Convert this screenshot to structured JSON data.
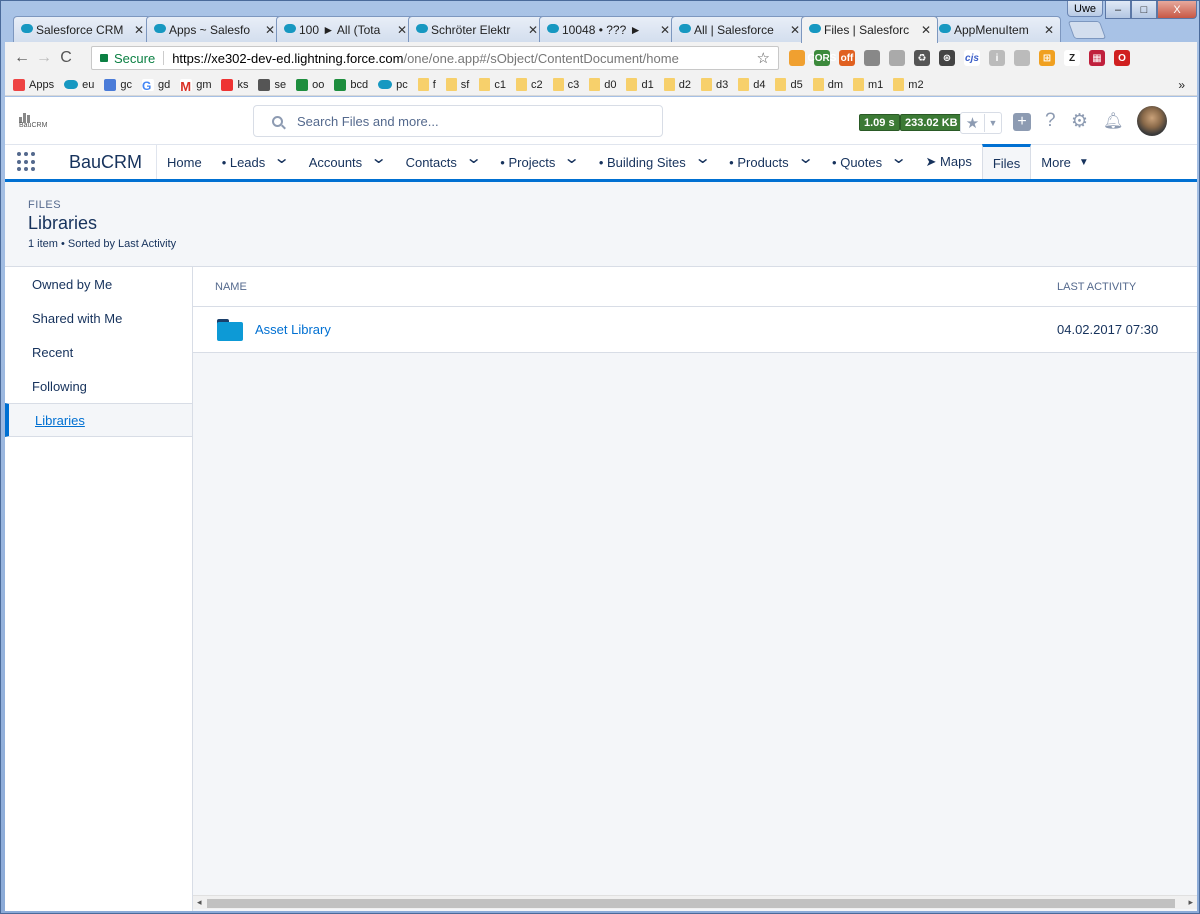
{
  "browser": {
    "user": "Uwe",
    "tabs": [
      {
        "label": "Salesforce CRM",
        "active": false
      },
      {
        "label": "Apps ~ Salesfo",
        "active": false
      },
      {
        "label": "100 ► All (Tota",
        "active": false
      },
      {
        "label": "Schröter Elektr",
        "active": false
      },
      {
        "label": "10048 • ??? ►",
        "active": false
      },
      {
        "label": "All | Salesforce",
        "active": false
      },
      {
        "label": "Files | Salesforc",
        "active": true
      },
      {
        "label": "AppMenuItem",
        "active": false
      }
    ],
    "address": {
      "secure_label": "Secure",
      "url_host": "https://xe302-dev-ed.lightning.force.com",
      "url_path": "/one/one.app#/sObject/ContentDocument/home"
    },
    "extensions": [
      {
        "name": "calculator-icon",
        "color": "#f0a030",
        "text": ""
      },
      {
        "name": "cors-icon",
        "color": "#3c8a3c",
        "text": "CORS"
      },
      {
        "name": "off-icon",
        "color": "#e06020",
        "text": "off"
      },
      {
        "name": "tab-icon",
        "color": "#888888",
        "text": ""
      },
      {
        "name": "drive-icon",
        "color": "#aaaaaa",
        "text": ""
      },
      {
        "name": "recycle-icon",
        "color": "#555555",
        "text": "♻"
      },
      {
        "name": "steering-icon",
        "color": "#444444",
        "text": "⊛"
      },
      {
        "name": "cjs-icon",
        "color": "#ffffff",
        "text": "cjs"
      },
      {
        "name": "info-icon",
        "color": "#bbbbbb",
        "text": "i"
      },
      {
        "name": "cloud-icon",
        "color": "#bbbbbb",
        "text": ""
      },
      {
        "name": "grid-ext-icon",
        "color": "#f0a020",
        "text": "⊞"
      },
      {
        "name": "z-icon",
        "color": "#ffffff",
        "text": "Z"
      },
      {
        "name": "flag-icon",
        "color": "#c0203c",
        "text": "▦"
      },
      {
        "name": "opera-icon",
        "color": "#d02020",
        "text": "O"
      }
    ],
    "bookmarks": [
      {
        "label": "Apps",
        "icon": "grid"
      },
      {
        "label": "eu",
        "icon": "sf"
      },
      {
        "label": "gc",
        "icon": "calendar"
      },
      {
        "label": "gd",
        "icon": "google"
      },
      {
        "label": "gm",
        "icon": "gmail"
      },
      {
        "label": "ks",
        "icon": "bank"
      },
      {
        "label": "se",
        "icon": "cloud"
      },
      {
        "label": "oo",
        "icon": "sheet"
      },
      {
        "label": "bcd",
        "icon": "sheet"
      },
      {
        "label": "pc",
        "icon": "sf"
      },
      {
        "label": "f",
        "icon": "folder"
      },
      {
        "label": "sf",
        "icon": "folder"
      },
      {
        "label": "c1",
        "icon": "folder"
      },
      {
        "label": "c2",
        "icon": "folder"
      },
      {
        "label": "c3",
        "icon": "folder"
      },
      {
        "label": "d0",
        "icon": "folder"
      },
      {
        "label": "d1",
        "icon": "folder"
      },
      {
        "label": "d2",
        "icon": "folder"
      },
      {
        "label": "d3",
        "icon": "folder"
      },
      {
        "label": "d4",
        "icon": "folder"
      },
      {
        "label": "d5",
        "icon": "folder"
      },
      {
        "label": "dm",
        "icon": "folder"
      },
      {
        "label": "m1",
        "icon": "folder"
      },
      {
        "label": "m2",
        "icon": "folder"
      }
    ],
    "bookmarks_more": "»"
  },
  "sf": {
    "logo_text": "BauCRM",
    "search_placeholder": "Search Files and more...",
    "perf_time": "1.09 s",
    "perf_size": "233.02 KB",
    "app_name": "BauCRM",
    "nav": [
      {
        "label": "Home",
        "chevron": false,
        "active": false
      },
      {
        "label": "• Leads",
        "chevron": true,
        "active": false
      },
      {
        "label": "Accounts",
        "chevron": true,
        "active": false
      },
      {
        "label": "Contacts",
        "chevron": true,
        "active": false
      },
      {
        "label": "• Projects",
        "chevron": true,
        "active": false
      },
      {
        "label": "• Building Sites",
        "chevron": true,
        "active": false
      },
      {
        "label": "• Products",
        "chevron": true,
        "active": false
      },
      {
        "label": "• Quotes",
        "chevron": true,
        "active": false
      },
      {
        "label": "➤ Maps",
        "chevron": false,
        "active": false
      },
      {
        "label": "Files",
        "chevron": false,
        "active": true
      }
    ],
    "nav_more": "More",
    "page": {
      "eyebrow": "FILES",
      "title": "Libraries",
      "meta": "1 item • Sorted by Last Activity"
    },
    "sidebar": [
      {
        "label": "Owned by Me",
        "active": false
      },
      {
        "label": "Shared with Me",
        "active": false
      },
      {
        "label": "Recent",
        "active": false
      },
      {
        "label": "Following",
        "active": false
      },
      {
        "label": "Libraries",
        "active": true
      }
    ],
    "table": {
      "col_name": "NAME",
      "col_activity": "LAST ACTIVITY",
      "rows": [
        {
          "name": "Asset Library",
          "last_activity": "04.02.2017 07:30"
        }
      ]
    }
  }
}
